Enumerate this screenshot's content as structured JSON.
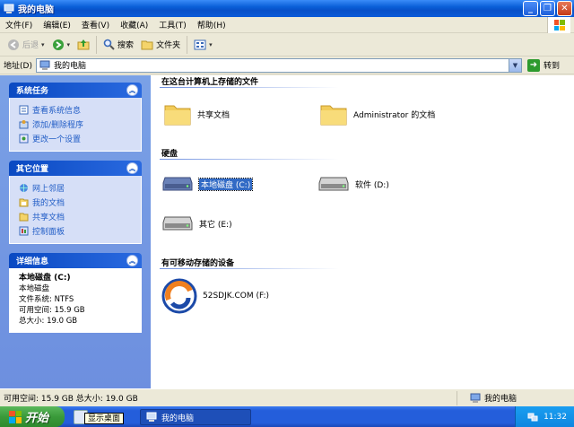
{
  "window": {
    "title": "我的电脑"
  },
  "menu": [
    "文件(F)",
    "编辑(E)",
    "查看(V)",
    "收藏(A)",
    "工具(T)",
    "帮助(H)"
  ],
  "toolbar": {
    "back": "后退",
    "search": "搜索",
    "folders": "文件夹"
  },
  "address": {
    "label": "地址(D)",
    "value": "我的电脑",
    "go": "转到"
  },
  "sidebar": {
    "system_tasks": {
      "title": "系统任务",
      "items": [
        "查看系统信息",
        "添加/删除程序",
        "更改一个设置"
      ]
    },
    "other_places": {
      "title": "其它位置",
      "items": [
        "网上邻居",
        "我的文档",
        "共享文档",
        "控制面板"
      ]
    },
    "details": {
      "title": "详细信息",
      "name": "本地磁盘 (C:)",
      "type": "本地磁盘",
      "fs": "文件系统: NTFS",
      "free": "可用空间: 15.9 GB",
      "total": "总大小: 19.0 GB"
    }
  },
  "content": {
    "groups": {
      "stored": "在这台计算机上存储的文件",
      "drives": "硬盘",
      "removable": "有可移动存储的设备"
    },
    "stored_items": [
      "共享文档",
      "Administrator 的文档"
    ],
    "drive_items": [
      "本地磁盘 (C:)",
      "软件 (D:)",
      "其它 (E:)"
    ],
    "removable_items": [
      "52SDJK.COM (F:)"
    ]
  },
  "status": {
    "left": "可用空间: 15.9 GB 总大小: 19.0 GB",
    "right": "我的电脑"
  },
  "taskbar": {
    "start": "开始",
    "tooltip": "显示桌面",
    "task": "我的电脑",
    "clock": "11:32"
  },
  "colors": {
    "link": "#215dc6",
    "pane": "#7aa1e6",
    "selection": "#316ac5"
  }
}
